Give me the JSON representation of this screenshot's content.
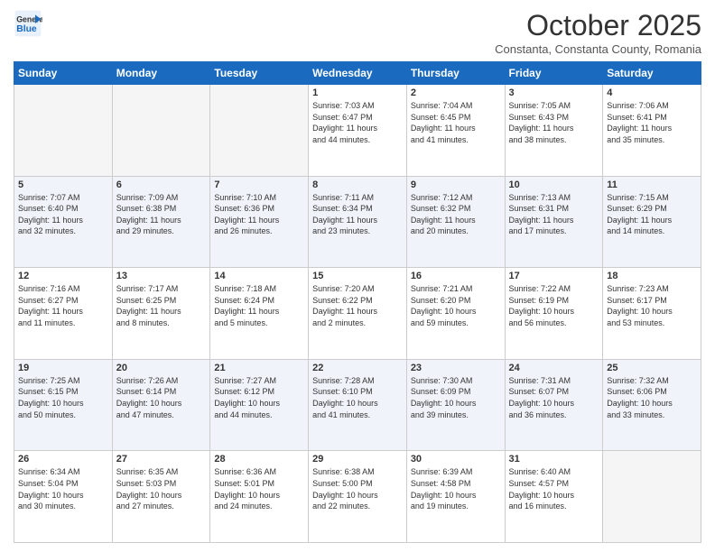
{
  "logo": {
    "line1": "General",
    "line2": "Blue"
  },
  "title": "October 2025",
  "subtitle": "Constanta, Constanta County, Romania",
  "weekdays": [
    "Sunday",
    "Monday",
    "Tuesday",
    "Wednesday",
    "Thursday",
    "Friday",
    "Saturday"
  ],
  "weeks": [
    [
      {
        "num": "",
        "info": ""
      },
      {
        "num": "",
        "info": ""
      },
      {
        "num": "",
        "info": ""
      },
      {
        "num": "1",
        "info": "Sunrise: 7:03 AM\nSunset: 6:47 PM\nDaylight: 11 hours\nand 44 minutes."
      },
      {
        "num": "2",
        "info": "Sunrise: 7:04 AM\nSunset: 6:45 PM\nDaylight: 11 hours\nand 41 minutes."
      },
      {
        "num": "3",
        "info": "Sunrise: 7:05 AM\nSunset: 6:43 PM\nDaylight: 11 hours\nand 38 minutes."
      },
      {
        "num": "4",
        "info": "Sunrise: 7:06 AM\nSunset: 6:41 PM\nDaylight: 11 hours\nand 35 minutes."
      }
    ],
    [
      {
        "num": "5",
        "info": "Sunrise: 7:07 AM\nSunset: 6:40 PM\nDaylight: 11 hours\nand 32 minutes."
      },
      {
        "num": "6",
        "info": "Sunrise: 7:09 AM\nSunset: 6:38 PM\nDaylight: 11 hours\nand 29 minutes."
      },
      {
        "num": "7",
        "info": "Sunrise: 7:10 AM\nSunset: 6:36 PM\nDaylight: 11 hours\nand 26 minutes."
      },
      {
        "num": "8",
        "info": "Sunrise: 7:11 AM\nSunset: 6:34 PM\nDaylight: 11 hours\nand 23 minutes."
      },
      {
        "num": "9",
        "info": "Sunrise: 7:12 AM\nSunset: 6:32 PM\nDaylight: 11 hours\nand 20 minutes."
      },
      {
        "num": "10",
        "info": "Sunrise: 7:13 AM\nSunset: 6:31 PM\nDaylight: 11 hours\nand 17 minutes."
      },
      {
        "num": "11",
        "info": "Sunrise: 7:15 AM\nSunset: 6:29 PM\nDaylight: 11 hours\nand 14 minutes."
      }
    ],
    [
      {
        "num": "12",
        "info": "Sunrise: 7:16 AM\nSunset: 6:27 PM\nDaylight: 11 hours\nand 11 minutes."
      },
      {
        "num": "13",
        "info": "Sunrise: 7:17 AM\nSunset: 6:25 PM\nDaylight: 11 hours\nand 8 minutes."
      },
      {
        "num": "14",
        "info": "Sunrise: 7:18 AM\nSunset: 6:24 PM\nDaylight: 11 hours\nand 5 minutes."
      },
      {
        "num": "15",
        "info": "Sunrise: 7:20 AM\nSunset: 6:22 PM\nDaylight: 11 hours\nand 2 minutes."
      },
      {
        "num": "16",
        "info": "Sunrise: 7:21 AM\nSunset: 6:20 PM\nDaylight: 10 hours\nand 59 minutes."
      },
      {
        "num": "17",
        "info": "Sunrise: 7:22 AM\nSunset: 6:19 PM\nDaylight: 10 hours\nand 56 minutes."
      },
      {
        "num": "18",
        "info": "Sunrise: 7:23 AM\nSunset: 6:17 PM\nDaylight: 10 hours\nand 53 minutes."
      }
    ],
    [
      {
        "num": "19",
        "info": "Sunrise: 7:25 AM\nSunset: 6:15 PM\nDaylight: 10 hours\nand 50 minutes."
      },
      {
        "num": "20",
        "info": "Sunrise: 7:26 AM\nSunset: 6:14 PM\nDaylight: 10 hours\nand 47 minutes."
      },
      {
        "num": "21",
        "info": "Sunrise: 7:27 AM\nSunset: 6:12 PM\nDaylight: 10 hours\nand 44 minutes."
      },
      {
        "num": "22",
        "info": "Sunrise: 7:28 AM\nSunset: 6:10 PM\nDaylight: 10 hours\nand 41 minutes."
      },
      {
        "num": "23",
        "info": "Sunrise: 7:30 AM\nSunset: 6:09 PM\nDaylight: 10 hours\nand 39 minutes."
      },
      {
        "num": "24",
        "info": "Sunrise: 7:31 AM\nSunset: 6:07 PM\nDaylight: 10 hours\nand 36 minutes."
      },
      {
        "num": "25",
        "info": "Sunrise: 7:32 AM\nSunset: 6:06 PM\nDaylight: 10 hours\nand 33 minutes."
      }
    ],
    [
      {
        "num": "26",
        "info": "Sunrise: 6:34 AM\nSunset: 5:04 PM\nDaylight: 10 hours\nand 30 minutes."
      },
      {
        "num": "27",
        "info": "Sunrise: 6:35 AM\nSunset: 5:03 PM\nDaylight: 10 hours\nand 27 minutes."
      },
      {
        "num": "28",
        "info": "Sunrise: 6:36 AM\nSunset: 5:01 PM\nDaylight: 10 hours\nand 24 minutes."
      },
      {
        "num": "29",
        "info": "Sunrise: 6:38 AM\nSunset: 5:00 PM\nDaylight: 10 hours\nand 22 minutes."
      },
      {
        "num": "30",
        "info": "Sunrise: 6:39 AM\nSunset: 4:58 PM\nDaylight: 10 hours\nand 19 minutes."
      },
      {
        "num": "31",
        "info": "Sunrise: 6:40 AM\nSunset: 4:57 PM\nDaylight: 10 hours\nand 16 minutes."
      },
      {
        "num": "",
        "info": ""
      }
    ]
  ]
}
